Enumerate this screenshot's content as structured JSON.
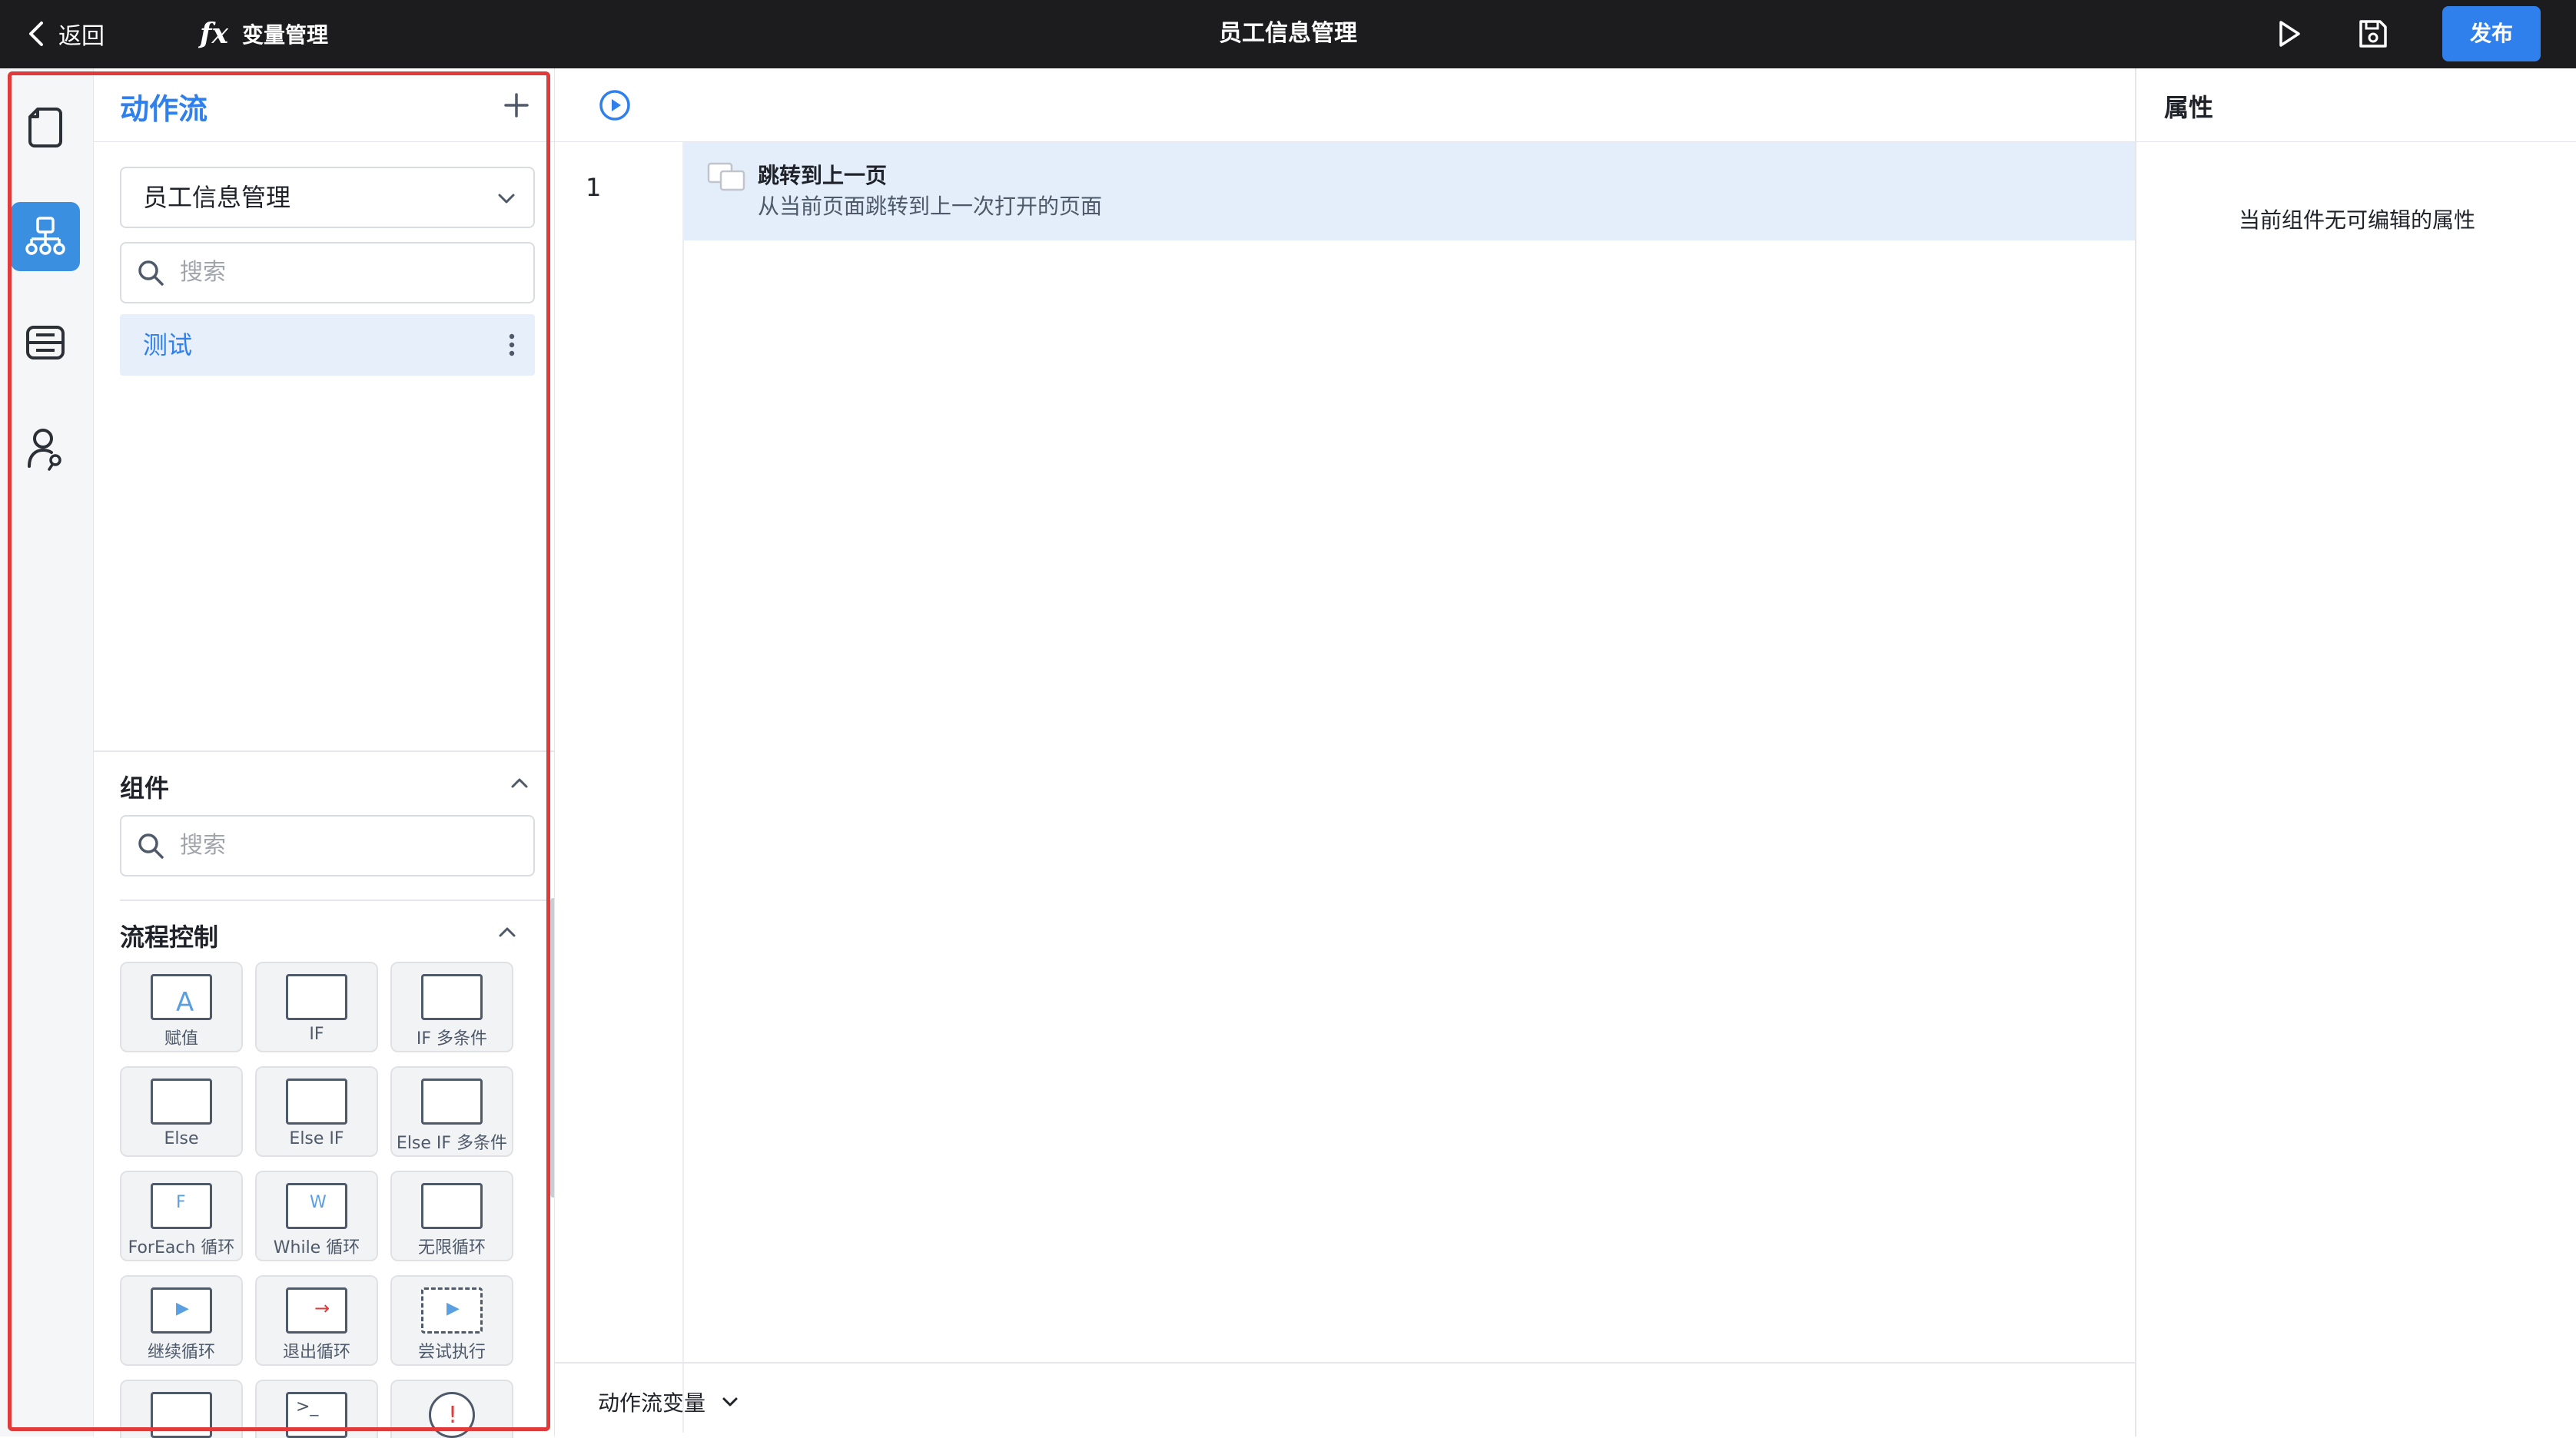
{
  "topbar": {
    "back_label": "返回",
    "fx_glyph": "fx",
    "variables_label": "变量管理",
    "title": "员工信息管理",
    "publish_label": "发布"
  },
  "rail": {
    "items": [
      {
        "icon": "page-icon",
        "active": false
      },
      {
        "icon": "action-flow-icon",
        "active": true
      },
      {
        "icon": "data-source-icon",
        "active": false
      },
      {
        "icon": "user-permission-icon",
        "active": false
      }
    ]
  },
  "panel": {
    "title": "动作流",
    "page_select_value": "员工信息管理",
    "search_placeholder": "搜索",
    "flows": [
      {
        "label": "测试",
        "selected": true
      }
    ],
    "components": {
      "title": "组件",
      "search_placeholder": "搜索",
      "group_title": "流程控制",
      "tiles": [
        "赋值",
        "IF",
        "IF 多条件",
        "Else",
        "Else IF",
        "Else IF 多条件",
        "ForEach 循环",
        "While 循环",
        "无限循环",
        "继续循环",
        "退出循环",
        "尝试执行"
      ]
    }
  },
  "canvas": {
    "line_number": "1",
    "step": {
      "title": "跳转到上一页",
      "description": "从当前页面跳转到上一次打开的页面"
    },
    "footer_label": "动作流变量"
  },
  "props": {
    "title": "属性",
    "empty_text": "当前组件无可编辑的属性"
  },
  "colors": {
    "accent": "#2f80ed",
    "topbar": "#1c1c1e",
    "selected_bg": "#e4eefa",
    "highlight_frame": "#e03a3a"
  }
}
